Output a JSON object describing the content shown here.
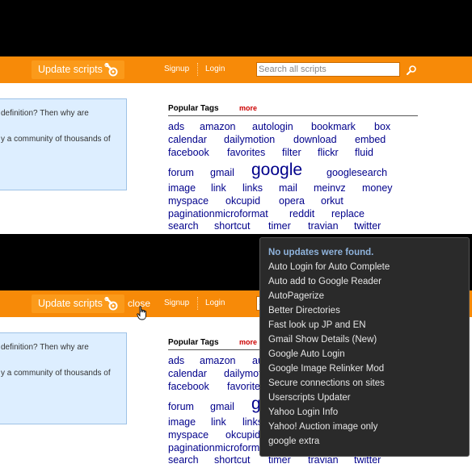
{
  "header": {
    "update_label": "Update scripts",
    "close_label": "close",
    "signup": "Signup",
    "login": "Login",
    "search_placeholder": "Search all scripts"
  },
  "info": {
    "line1": "definition? Then why are",
    "line2": "y a community of thousands of"
  },
  "tags": {
    "title": "Popular Tags",
    "more": "more",
    "items": [
      "ads",
      "amazon",
      "autologin",
      "bookmark",
      "box",
      "calendar",
      "dailymotion",
      "download",
      "embed",
      "facebook",
      "favorites",
      "filter",
      "flickr",
      "fluid",
      "forum",
      "gmail",
      "google",
      "googlesearch",
      "image",
      "link",
      "links",
      "mail",
      "meinvz",
      "money",
      "myspace",
      "okcupid",
      "opera",
      "orkut",
      "paginationmicroformat",
      "reddit",
      "replace",
      "search",
      "shortcut",
      "timer",
      "travian",
      "twitter"
    ]
  },
  "popup": {
    "heading": "No updates were found.",
    "items": [
      "Auto Login for Auto Complete",
      "Auto add to Google Reader",
      "AutoPagerize",
      "Better Directories",
      "Fast look up JP and EN",
      "Gmail Show Details (New)",
      "Google Auto Login",
      "Google Image Relinker Mod",
      "Secure connections on sites",
      "Userscripts Updater",
      "Yahoo Login Info",
      "Yahoo! Auction image only",
      "google extra"
    ]
  },
  "colors": {
    "bar": "#f78a08",
    "tag": "#00008b",
    "more": "#cc0000",
    "popup_bg": "#2a2a2a",
    "popup_heading": "#8fb3dc"
  },
  "icons": [
    "wrench-gear-icon",
    "magnifier-icon",
    "hand-cursor-icon"
  ]
}
